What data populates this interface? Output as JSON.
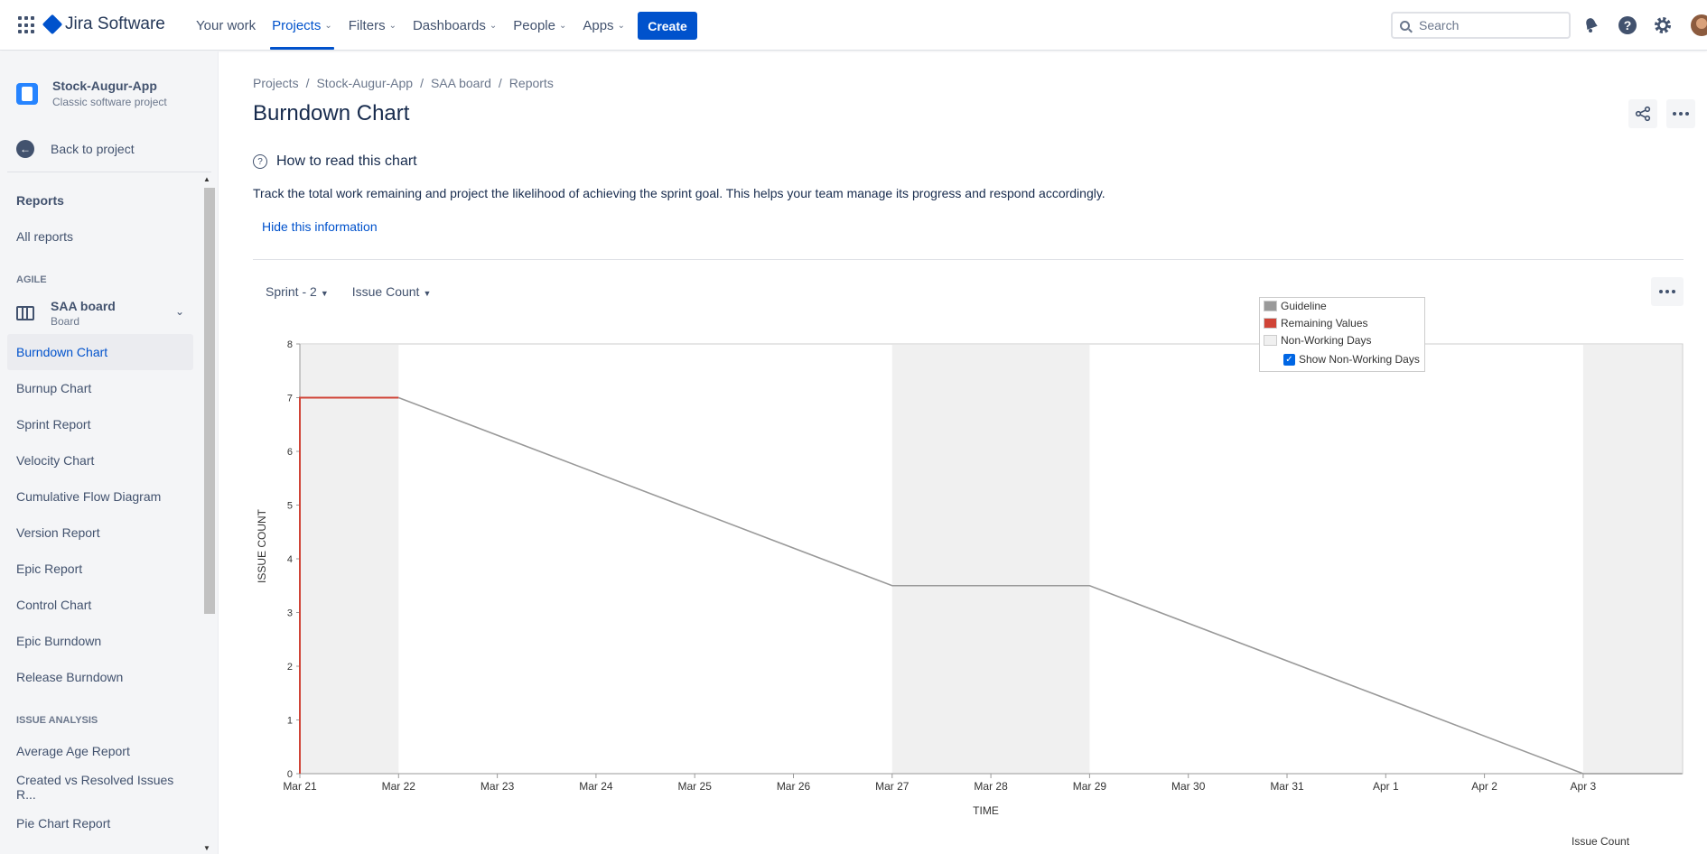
{
  "topnav": {
    "product": "Jira Software",
    "items": [
      {
        "label": "Your work",
        "caret": false,
        "active": false
      },
      {
        "label": "Projects",
        "caret": true,
        "active": true
      },
      {
        "label": "Filters",
        "caret": true,
        "active": false
      },
      {
        "label": "Dashboards",
        "caret": true,
        "active": false
      },
      {
        "label": "People",
        "caret": true,
        "active": false
      },
      {
        "label": "Apps",
        "caret": true,
        "active": false
      }
    ],
    "create_label": "Create",
    "search_placeholder": "Search"
  },
  "sidebar": {
    "project_name": "Stock-Augur-App",
    "project_type": "Classic software project",
    "back_label": "Back to project",
    "reports_heading": "Reports",
    "all_reports": "All reports",
    "agile_group": "AGILE",
    "board_name": "SAA board",
    "board_sub": "Board",
    "agile_items": [
      "Burndown Chart",
      "Burnup Chart",
      "Sprint Report",
      "Velocity Chart",
      "Cumulative Flow Diagram",
      "Version Report",
      "Epic Report",
      "Control Chart",
      "Epic Burndown",
      "Release Burndown"
    ],
    "selected_item": "Burndown Chart",
    "issue_group": "ISSUE ANALYSIS",
    "issue_items": [
      "Average Age Report",
      "Created vs Resolved Issues R...",
      "Pie Chart Report"
    ]
  },
  "main": {
    "breadcrumbs": [
      "Projects",
      "Stock-Augur-App",
      "SAA board",
      "Reports"
    ],
    "title": "Burndown Chart",
    "howto_title": "How to read this chart",
    "description": "Track the total work remaining and project the likelihood of achieving the sprint goal. This helps your team manage its progress and respond accordingly.",
    "hide_link": "Hide this information",
    "sprint_select": "Sprint - 2",
    "estimate_select": "Issue Count",
    "footer_label": "Issue Count"
  },
  "legend": {
    "guideline": "Guideline",
    "remaining": "Remaining Values",
    "nonworking": "Non-Working Days",
    "show_nonworking": "Show Non-Working Days",
    "show_nonworking_checked": true,
    "colors": {
      "guideline": "#999999",
      "remaining": "#d04437",
      "nonworking": "#f0f0f0"
    }
  },
  "chart_data": {
    "type": "line",
    "xlabel": "TIME",
    "ylabel": "ISSUE COUNT",
    "ylim": [
      0,
      8
    ],
    "yticks": [
      0,
      1,
      2,
      3,
      4,
      5,
      6,
      7,
      8
    ],
    "xticks": [
      "Mar 21",
      "Mar 22",
      "Mar 23",
      "Mar 24",
      "Mar 25",
      "Mar 26",
      "Mar 27",
      "Mar 28",
      "Mar 29",
      "Mar 30",
      "Mar 31",
      "Apr 1",
      "Apr 2",
      "Apr 3"
    ],
    "non_working_days": [
      [
        "Mar 21",
        "Mar 22"
      ],
      [
        "Mar 27",
        "Mar 29"
      ],
      [
        "Apr 3",
        "Apr 4"
      ]
    ],
    "series": [
      {
        "name": "Guideline",
        "color": "#999999",
        "x": [
          "Mar 22",
          "Mar 27",
          "Mar 29",
          "Apr 3",
          "Apr 4"
        ],
        "y": [
          7,
          3.5,
          3.5,
          0,
          0
        ]
      },
      {
        "name": "Remaining Values",
        "color": "#d04437",
        "x": [
          "Mar 21",
          "Mar 21",
          "Mar 22"
        ],
        "y": [
          0,
          7,
          7
        ]
      }
    ],
    "grid": false,
    "legend_position": "top-right"
  }
}
